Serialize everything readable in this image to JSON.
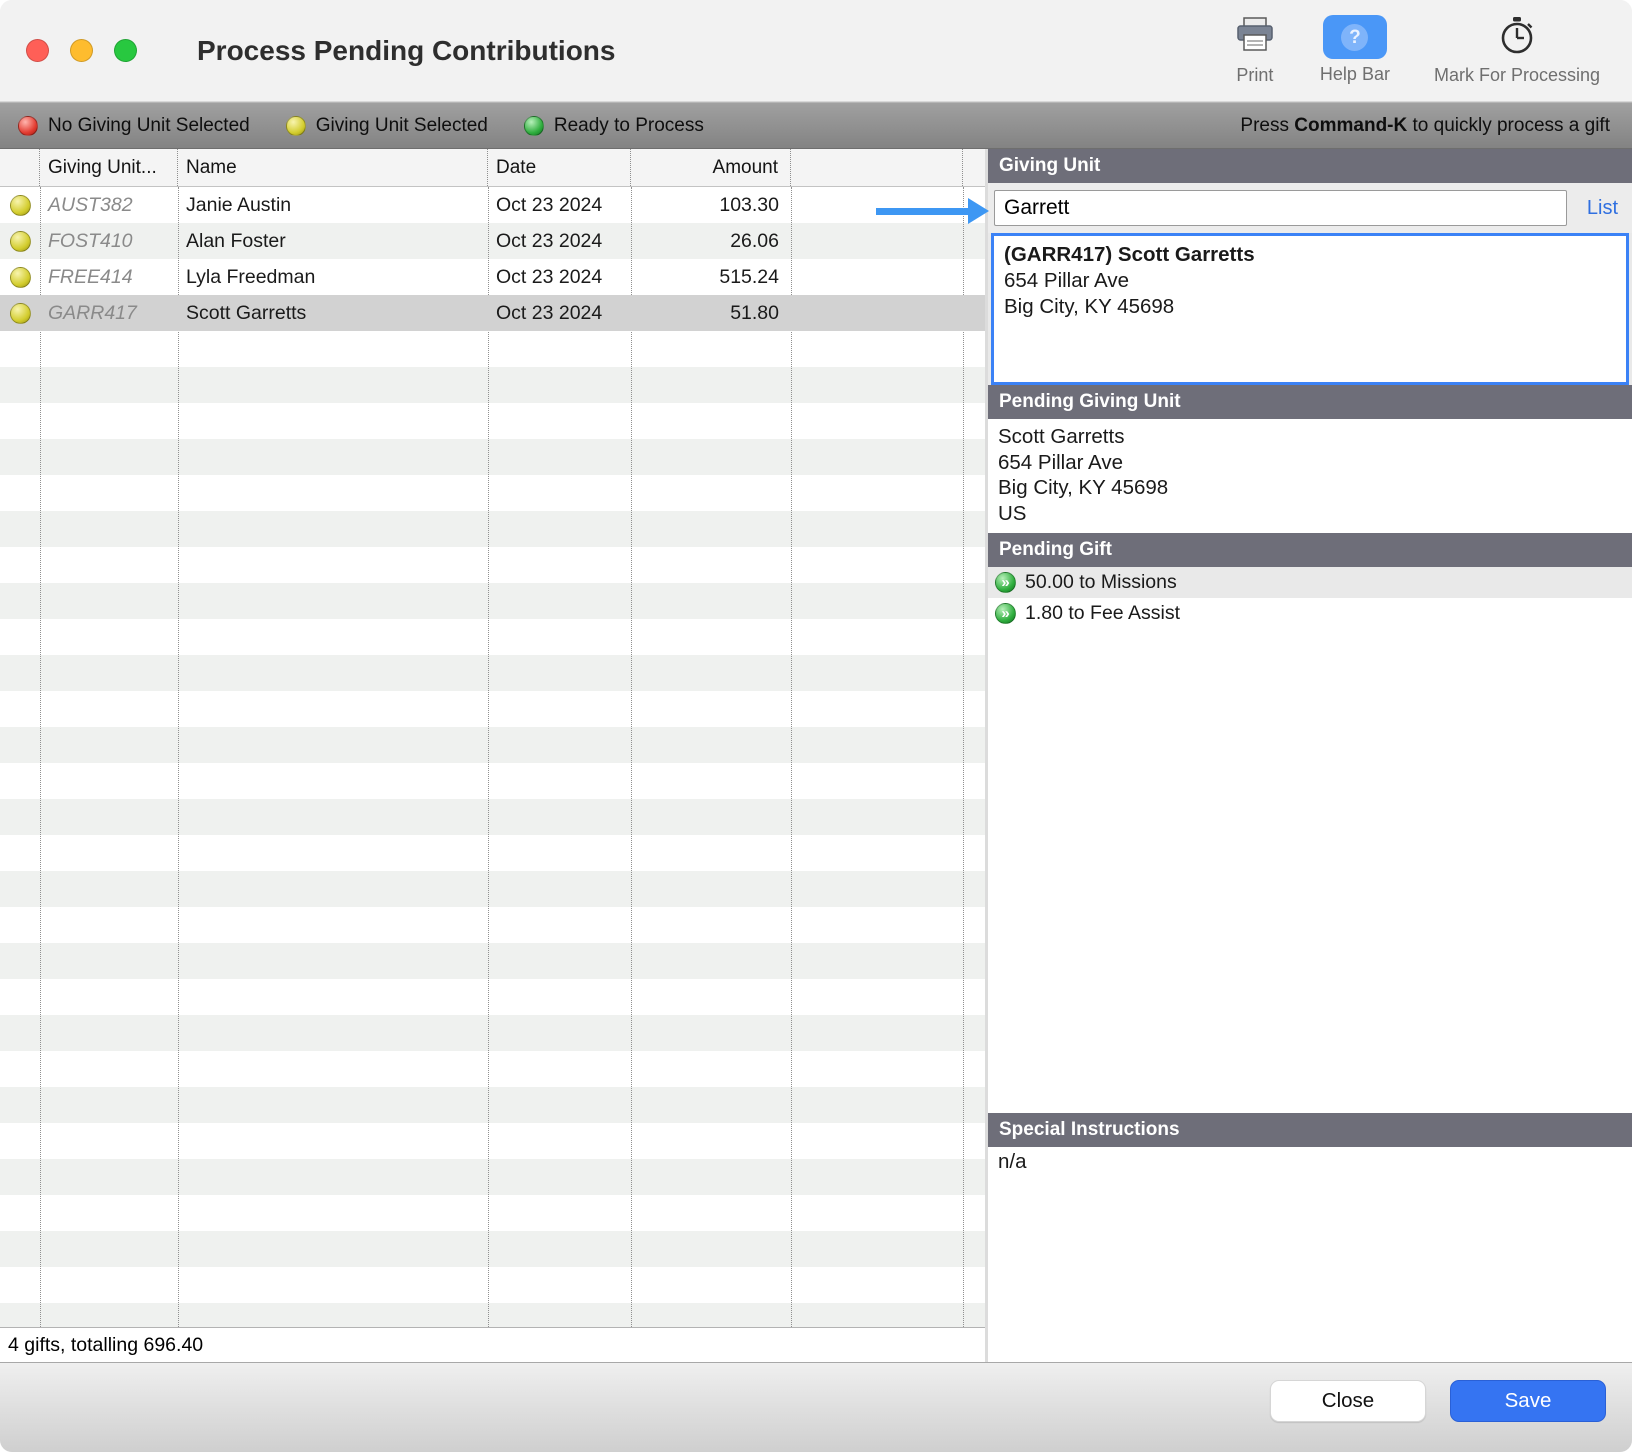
{
  "colors": {
    "accent_blue": "#3b82f6",
    "section_header_bg": "#6e6e79",
    "selected_row": "#d2d2d2",
    "status_red": "#e23b30",
    "status_yellow": "#d3cd2e",
    "status_green": "#2fae3e",
    "save_button": "#3574f2"
  },
  "titlebar": {
    "title": "Process Pending Contributions",
    "print_label": "Print",
    "help_bar_label": "Help Bar",
    "help_icon_glyph": "?",
    "mark_label": "Mark For Processing"
  },
  "legend": {
    "items": [
      {
        "label": "No Giving Unit Selected",
        "color": "#e23b30"
      },
      {
        "label": "Giving Unit Selected",
        "color": "#d3cd2e"
      },
      {
        "label": "Ready to Process",
        "color": "#2fae3e"
      }
    ],
    "hint_prefix": "Press ",
    "hint_key": "Command-K",
    "hint_suffix": " to quickly process a gift"
  },
  "table": {
    "columns": {
      "unit": "Giving Unit...",
      "name": "Name",
      "date": "Date",
      "amount": "Amount"
    },
    "rows": [
      {
        "unit": "AUST382",
        "name": "Janie Austin",
        "date": "Oct 23 2024",
        "amount": "103.30",
        "status": "yellow"
      },
      {
        "unit": "FOST410",
        "name": "Alan Foster",
        "date": "Oct 23 2024",
        "amount": "26.06",
        "status": "yellow"
      },
      {
        "unit": "FREE414",
        "name": "Lyla Freedman",
        "date": "Oct 23 2024",
        "amount": "515.24",
        "status": "yellow"
      },
      {
        "unit": "GARR417",
        "name": "Scott Garretts",
        "date": "Oct 23 2024",
        "amount": "51.80",
        "status": "yellow",
        "selected": true
      }
    ],
    "status_text": "4 gifts, totalling 696.40"
  },
  "panel": {
    "giving_unit": {
      "header": "Giving Unit",
      "search_value": "Garrett",
      "list_label": "List",
      "result": {
        "title": "(GARR417) Scott Garretts",
        "line1": "654 Pillar Ave",
        "line2": "Big City, KY  45698"
      }
    },
    "pending_giving_unit": {
      "header": "Pending Giving Unit",
      "line1": "Scott Garretts",
      "line2": "654 Pillar Ave",
      "line3": "Big City, KY  45698",
      "line4": "US"
    },
    "pending_gift": {
      "header": "Pending Gift",
      "icon_glyph": "»",
      "items": [
        {
          "label": "50.00 to Missions"
        },
        {
          "label": "1.80 to Fee Assist"
        }
      ]
    },
    "special_instructions": {
      "header": "Special Instructions",
      "value": "n/a"
    }
  },
  "footer": {
    "close_label": "Close",
    "save_label": "Save"
  }
}
